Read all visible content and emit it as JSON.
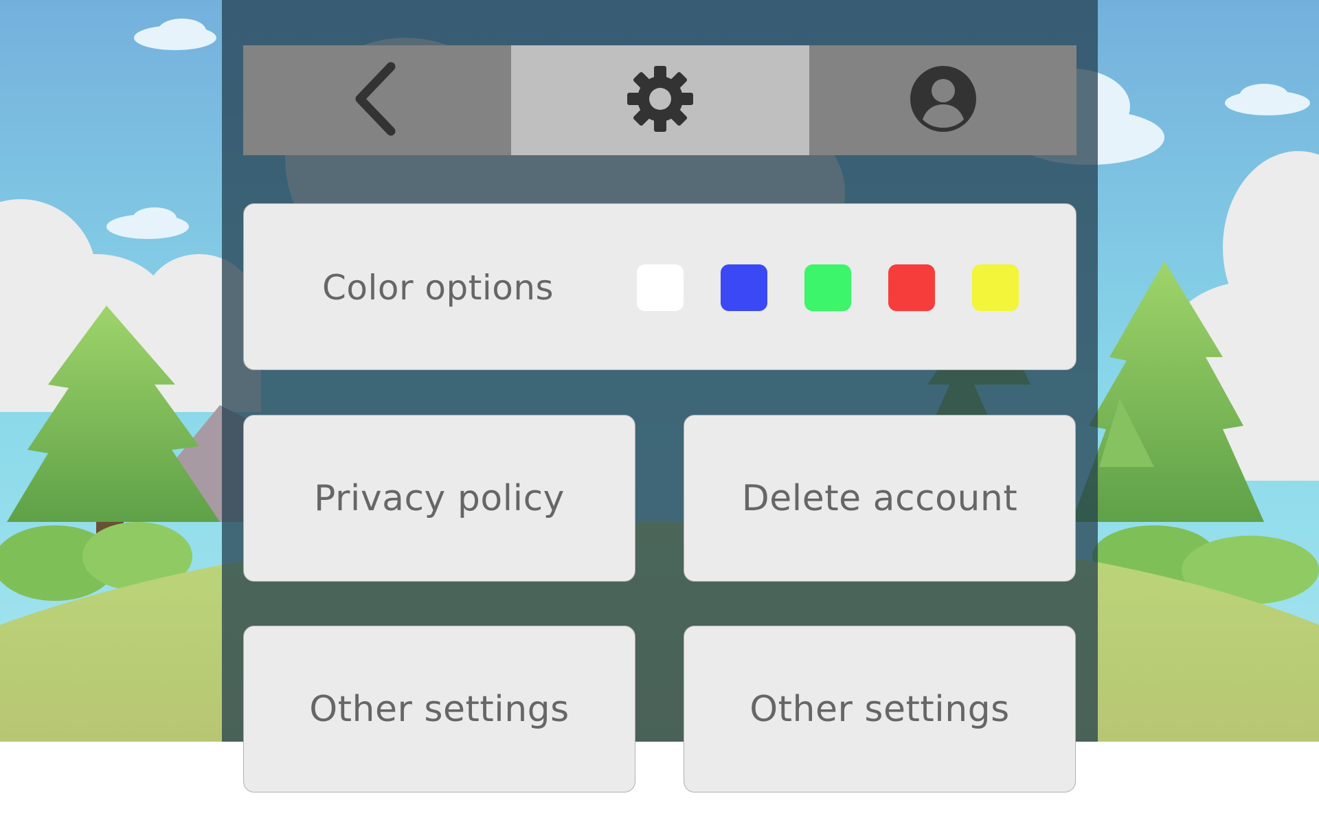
{
  "toolbar": {
    "back_icon": "chevron-left-icon",
    "settings_icon": "gear-icon",
    "profile_icon": "account-circle-icon",
    "active_tab": "settings"
  },
  "color_options": {
    "label": "Color options",
    "swatches": [
      {
        "name": "white",
        "color": "#ffffff"
      },
      {
        "name": "blue",
        "color": "#3b48f5"
      },
      {
        "name": "green",
        "color": "#3cf56a"
      },
      {
        "name": "red",
        "color": "#f73c3c"
      },
      {
        "name": "yellow",
        "color": "#f2f53a"
      }
    ]
  },
  "buttons": {
    "privacy": "Privacy policy",
    "delete": "Delete account",
    "other_1": "Other settings",
    "other_2": "Other settings"
  },
  "colors": {
    "toolbar_bg": "#838383",
    "toolbar_active": "#bfbfbf",
    "card_bg": "#ebebeb",
    "text": "#666666",
    "icon": "#333333"
  }
}
